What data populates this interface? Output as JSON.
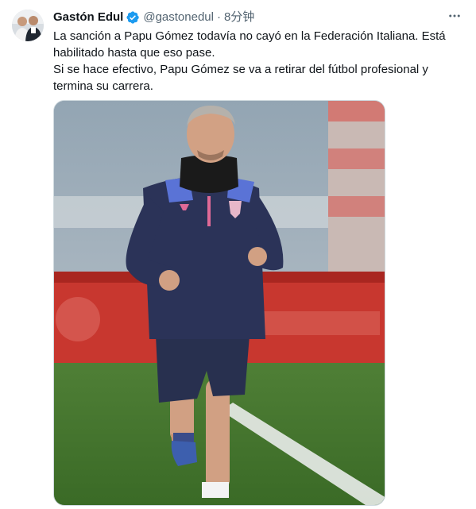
{
  "author": {
    "display_name": "Gastón Edul",
    "handle": "@gastonedul",
    "separator": "·",
    "timestamp": "8分钟",
    "verified": true,
    "verified_color": "#1d9bf0"
  },
  "tweet": {
    "lines": [
      "La sanción a Papu Gómez todavía no cayó en la Federación Italiana. Está habilitado hasta que eso pase.",
      "Si se hace efectivo, Papu Gómez se va a retirar del fútbol profesional y termina su carrera."
    ]
  },
  "icons": {
    "verified": "verified-badge-icon",
    "more": "more-horizontal-icon"
  },
  "colors": {
    "text_primary": "#0f1419",
    "text_secondary": "#536471",
    "media_border": "#cfd9de"
  }
}
